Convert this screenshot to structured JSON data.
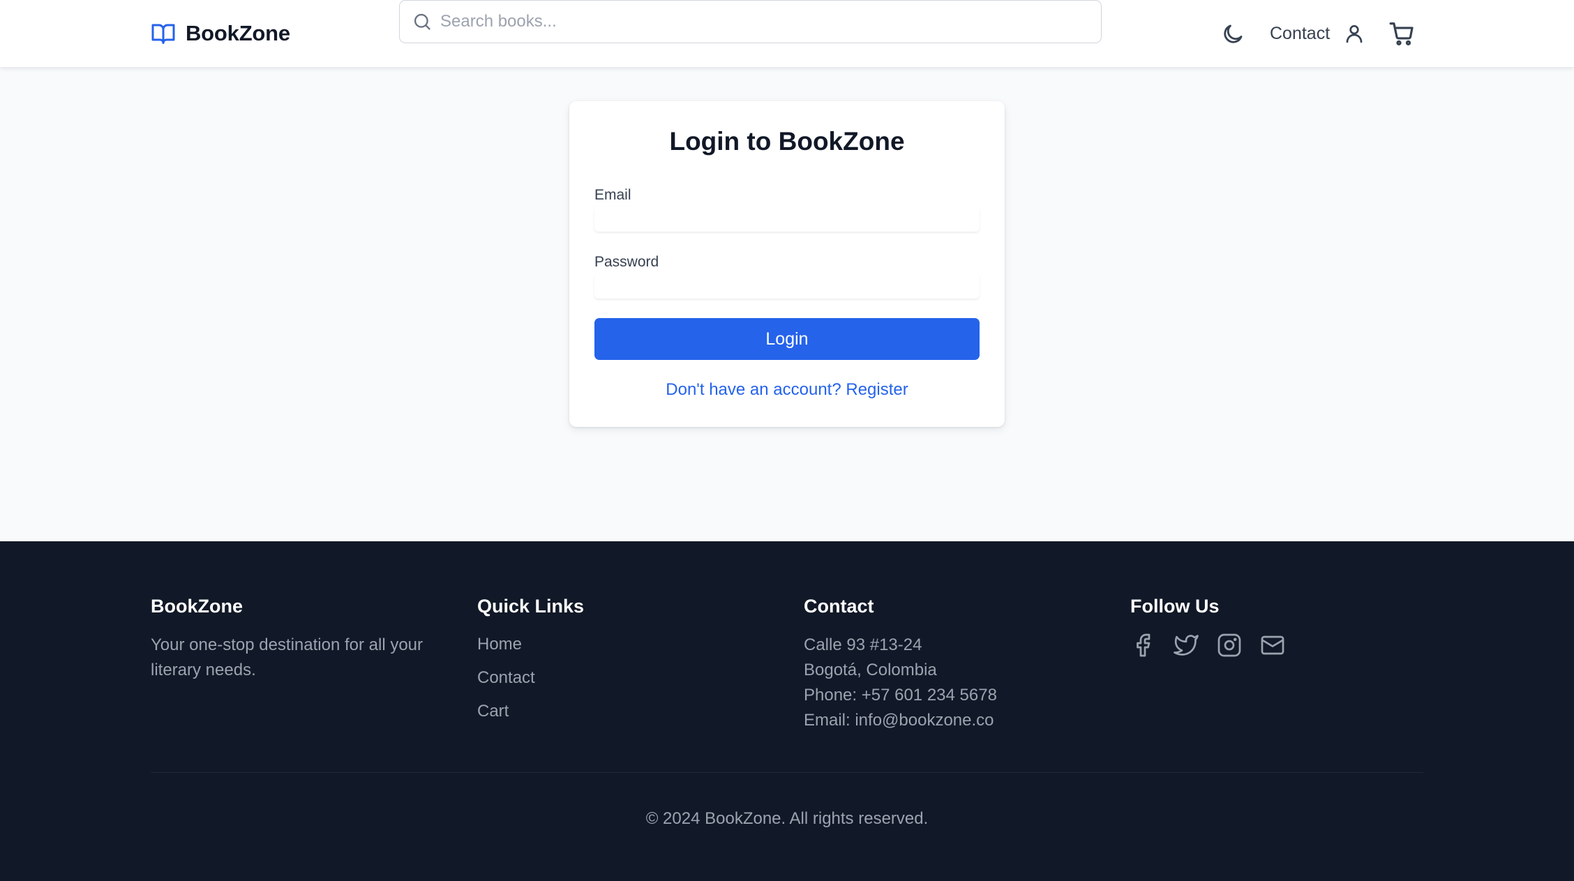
{
  "header": {
    "brand_name": "BookZone",
    "search_placeholder": "Search books...",
    "nav_contact": "Contact",
    "icons": [
      "book-open-icon",
      "search-icon",
      "moon-icon",
      "user-icon",
      "shopping-cart-icon"
    ]
  },
  "login": {
    "title": "Login to BookZone",
    "email_label": "Email",
    "email_value": "",
    "password_label": "Password",
    "password_value": "",
    "submit_label": "Login",
    "register_text": "Don't have an account? Register"
  },
  "footer": {
    "brand": {
      "heading": "BookZone",
      "tagline": "Your one-stop destination for all your literary needs."
    },
    "quick_links": {
      "heading": "Quick Links",
      "items": [
        "Home",
        "Contact",
        "Cart"
      ]
    },
    "contact": {
      "heading": "Contact",
      "lines": [
        "Calle 93 #13-24",
        "Bogotá, Colombia",
        "Phone: +57 601 234 5678",
        "Email: info@bookzone.co"
      ]
    },
    "follow": {
      "heading": "Follow Us",
      "icons": [
        "facebook-icon",
        "twitter-icon",
        "instagram-icon",
        "mail-icon"
      ]
    },
    "copyright": "© 2024 BookZone. All rights reserved."
  },
  "colors": {
    "accent": "#2563eb",
    "page_background": "#f8fafc",
    "footer_background": "#111827",
    "footer_text": "#9ca3af"
  }
}
